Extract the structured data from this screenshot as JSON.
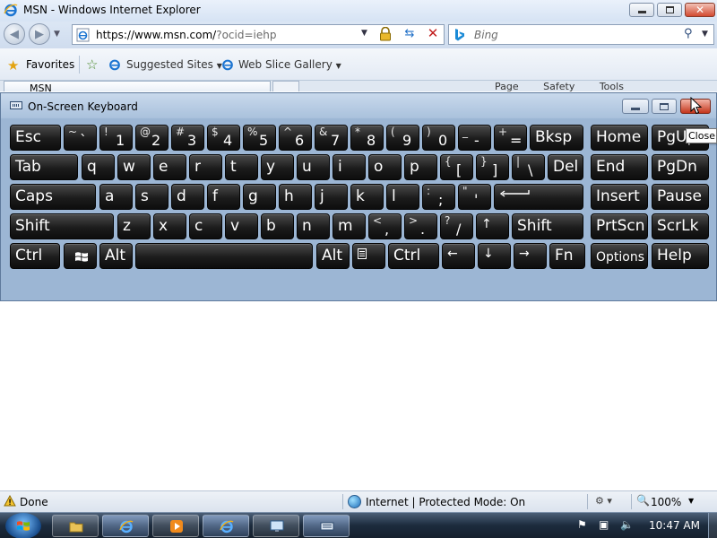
{
  "window": {
    "title": "MSN - Windows Internet Explorer"
  },
  "address_bar": {
    "url_main": "https://www.msn.com/",
    "url_query": "?ocid=iehp"
  },
  "search_box": {
    "placeholder": "Bing"
  },
  "favorites_bar": {
    "favorites_label": "Favorites",
    "items": [
      {
        "label": "Suggested Sites"
      },
      {
        "label": "Web Slice Gallery"
      }
    ]
  },
  "tabs": {
    "active_tab_label": "MSN"
  },
  "command_bar": {
    "items": [
      "Page",
      "Safety",
      "Tools"
    ]
  },
  "osk": {
    "title": "On-Screen Keyboard",
    "tooltip": "Close",
    "rows": [
      [
        {
          "label": "Esc"
        },
        {
          "shift": "~",
          "label": "`"
        },
        {
          "shift": "!",
          "label": "1"
        },
        {
          "shift": "@",
          "label": "2"
        },
        {
          "shift": "#",
          "label": "3"
        },
        {
          "shift": "$",
          "label": "4"
        },
        {
          "shift": "%",
          "label": "5"
        },
        {
          "shift": "^",
          "label": "6"
        },
        {
          "shift": "&",
          "label": "7"
        },
        {
          "shift": "*",
          "label": "8"
        },
        {
          "shift": "(",
          "label": "9"
        },
        {
          "shift": ")",
          "label": "0"
        },
        {
          "shift": "_",
          "label": "-"
        },
        {
          "shift": "+",
          "label": "="
        },
        {
          "label": "Bksp"
        },
        {
          "label": "Home"
        },
        {
          "label": "PgUp"
        }
      ],
      [
        {
          "label": "Tab"
        },
        {
          "label": "q"
        },
        {
          "label": "w"
        },
        {
          "label": "e"
        },
        {
          "label": "r"
        },
        {
          "label": "t"
        },
        {
          "label": "y"
        },
        {
          "label": "u"
        },
        {
          "label": "i"
        },
        {
          "label": "o"
        },
        {
          "label": "p"
        },
        {
          "shift": "{",
          "label": "["
        },
        {
          "shift": "}",
          "label": "]"
        },
        {
          "shift": "|",
          "label": "\\"
        },
        {
          "label": "Del"
        },
        {
          "label": "End"
        },
        {
          "label": "PgDn"
        }
      ],
      [
        {
          "label": "Caps"
        },
        {
          "label": "a"
        },
        {
          "label": "s"
        },
        {
          "label": "d"
        },
        {
          "label": "f"
        },
        {
          "label": "g"
        },
        {
          "label": "h"
        },
        {
          "label": "j"
        },
        {
          "label": "k"
        },
        {
          "label": "l"
        },
        {
          "shift": ":",
          "label": ";"
        },
        {
          "shift": "\"",
          "label": "'"
        },
        {
          "label": "Enter",
          "icon": "enter-arrow"
        },
        {
          "label": "Insert"
        },
        {
          "label": "Pause"
        }
      ],
      [
        {
          "label": "Shift"
        },
        {
          "label": "z"
        },
        {
          "label": "x"
        },
        {
          "label": "c"
        },
        {
          "label": "v"
        },
        {
          "label": "b"
        },
        {
          "label": "n"
        },
        {
          "label": "m"
        },
        {
          "shift": "<",
          "label": ","
        },
        {
          "shift": ">",
          "label": "."
        },
        {
          "shift": "?",
          "label": "/"
        },
        {
          "label": "↑"
        },
        {
          "label": "Shift"
        },
        {
          "label": "PrtScn"
        },
        {
          "label": "ScrLk"
        }
      ],
      [
        {
          "label": "Ctrl"
        },
        {
          "label": "Win",
          "icon": "windows-logo"
        },
        {
          "label": "Alt"
        },
        {
          "label": "",
          "icon": "space"
        },
        {
          "label": "Alt"
        },
        {
          "label": "Menu",
          "icon": "menu"
        },
        {
          "label": "Ctrl"
        },
        {
          "label": "←"
        },
        {
          "label": "↓"
        },
        {
          "label": "→"
        },
        {
          "label": "Fn"
        },
        {
          "label": "Options"
        },
        {
          "label": "Help"
        }
      ]
    ]
  },
  "status_bar": {
    "status": "Done",
    "zone": "Internet | Protected Mode: On",
    "zoom": "100%"
  },
  "taskbar": {
    "clock": "10:47 AM",
    "buttons": [
      "explorer",
      "internet-explorer",
      "media-player",
      "internet-explorer-2",
      "remote-desktop",
      "on-screen-keyboard"
    ]
  }
}
